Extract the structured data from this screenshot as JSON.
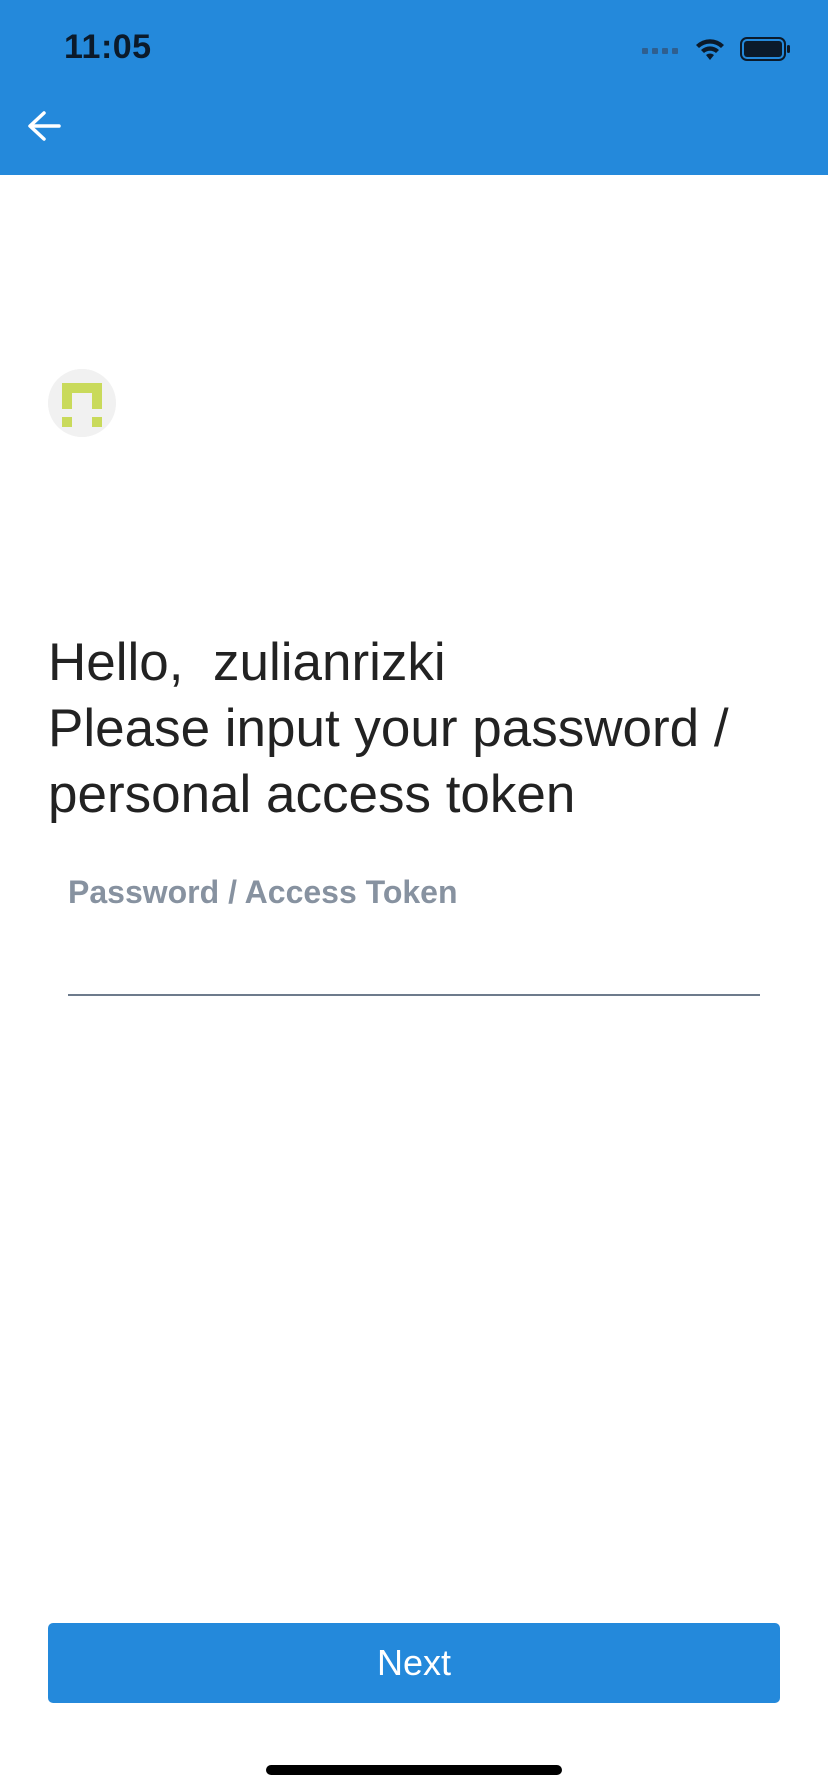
{
  "status_bar": {
    "time": "11:05",
    "icons": [
      "cellular-signal-icon",
      "wifi-icon",
      "battery-icon"
    ]
  },
  "app_bar": {
    "back_icon": "arrow-left-icon",
    "background_color": "#2489DB"
  },
  "profile": {
    "avatar_icon": "user-avatar-icon",
    "avatar_color": "#C9DA5B"
  },
  "greeting": {
    "hello": "Hello,",
    "username": "zulianrizki",
    "line2": "Please input your password /",
    "line3": "personal access token"
  },
  "password_field": {
    "label": "Password / Access Token",
    "value": ""
  },
  "actions": {
    "next_label": "Next",
    "accent_color": "#2489DB"
  }
}
